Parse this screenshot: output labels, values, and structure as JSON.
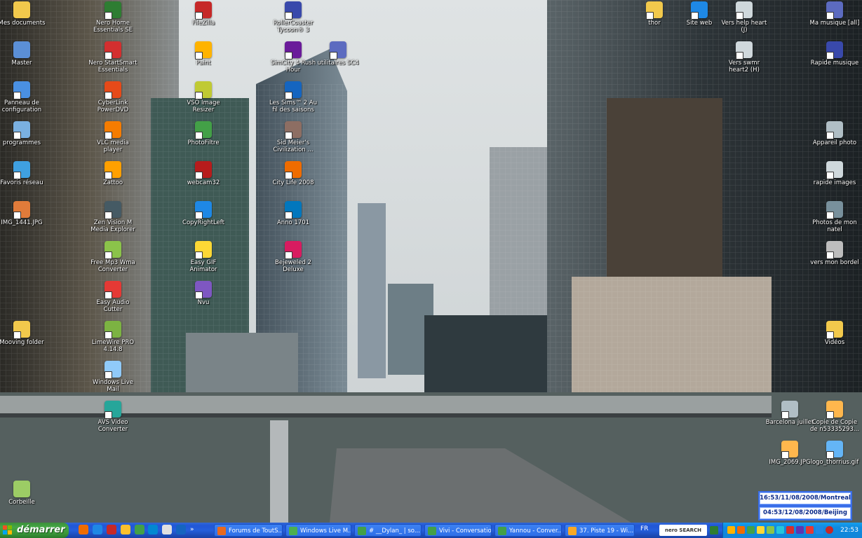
{
  "colors": {
    "taskbar": "#245edb",
    "start_button": "#3c973a",
    "tray": "#1285d8",
    "clock_text": "#0a2a8a"
  },
  "desktop_icons": [
    {
      "label": "Mes documents",
      "icon": "folder-documents-icon",
      "color": "#f2c94c"
    },
    {
      "label": "Master",
      "icon": "computer-icon",
      "color": "#5b8fd6"
    },
    {
      "label": "Panneau de configuration",
      "icon": "control-panel-icon",
      "color": "#4a90e2"
    },
    {
      "label": "programmes",
      "icon": "programs-icon",
      "color": "#7ab0e0"
    },
    {
      "label": "Favoris réseau",
      "icon": "network-icon",
      "color": "#3fa0e0"
    },
    {
      "label": "IMG_1441.JPG",
      "icon": "image-file-icon",
      "color": "#e07b3a"
    },
    {
      "label": "Mooving folder",
      "icon": "folder-icon",
      "color": "#f2c94c"
    },
    {
      "label": "Corbeille",
      "icon": "recycle-bin-icon",
      "color": "#9ccc65"
    },
    {
      "label": "Nero Home Essentials SE",
      "icon": "nero-home-icon",
      "color": "#2e7d32"
    },
    {
      "label": "Nero StartSmart Essentials",
      "icon": "nero-startsmart-icon",
      "color": "#d32f2f"
    },
    {
      "label": "CyberLink PowerDVD",
      "icon": "powerdvd-icon",
      "color": "#e64a19"
    },
    {
      "label": "VLC media player",
      "icon": "vlc-icon",
      "color": "#f57c00"
    },
    {
      "label": "Zattoo",
      "icon": "zattoo-icon",
      "color": "#ffa000"
    },
    {
      "label": "Zen Vision M Media Explorer",
      "icon": "zen-explorer-icon",
      "color": "#455a64"
    },
    {
      "label": "Free Mp3 Wma Converter",
      "icon": "mp3-converter-icon",
      "color": "#8bc34a"
    },
    {
      "label": "Easy Audio Cutter",
      "icon": "audio-cutter-icon",
      "color": "#e53935"
    },
    {
      "label": "LimeWire PRO 4.14.8",
      "icon": "limewire-icon",
      "color": "#7cb342"
    },
    {
      "label": "Windows Live Mail",
      "icon": "live-mail-icon",
      "color": "#90caf9"
    },
    {
      "label": "AVS Video Converter",
      "icon": "avs-converter-icon",
      "color": "#26a69a"
    },
    {
      "label": "FileZilla",
      "icon": "filezilla-icon",
      "color": "#c62828"
    },
    {
      "label": "Paint",
      "icon": "paint-icon",
      "color": "#ffb300"
    },
    {
      "label": "VSO Image Resizer",
      "icon": "image-resizer-icon",
      "color": "#c0ca33"
    },
    {
      "label": "PhotoFiltre",
      "icon": "photofiltre-icon",
      "color": "#43a047"
    },
    {
      "label": "webcam32",
      "icon": "webcam-icon",
      "color": "#b71c1c"
    },
    {
      "label": "CopyRightLeft",
      "icon": "copyrightleft-icon",
      "color": "#1e88e5"
    },
    {
      "label": "Easy GIF Animator",
      "icon": "gif-animator-icon",
      "color": "#fdd835"
    },
    {
      "label": "Nvu",
      "icon": "nvu-icon",
      "color": "#7e57c2"
    },
    {
      "label": "RollerCoaster Tycoon® 3",
      "icon": "rollercoaster-icon",
      "color": "#3949ab"
    },
    {
      "label": "SimCity 4 Rush Hour",
      "icon": "simcity-icon",
      "color": "#6a1b9a"
    },
    {
      "label": "utilitaires SC4",
      "icon": "gear-icon",
      "color": "#5c6bc0"
    },
    {
      "label": "Les Sims™ 2 Au fil des saisons",
      "icon": "sims-icon",
      "color": "#1565c0"
    },
    {
      "label": "Sid Meier's Civilization ...",
      "icon": "civilization-icon",
      "color": "#8d6e63"
    },
    {
      "label": "City Life 2008",
      "icon": "city-life-icon",
      "color": "#ef6c00"
    },
    {
      "label": "Anno 1701",
      "icon": "anno-icon",
      "color": "#0277bd"
    },
    {
      "label": "Bejeweled 2 Deluxe",
      "icon": "bejeweled-icon",
      "color": "#d81b60"
    },
    {
      "label": "thor",
      "icon": "folder-icon",
      "color": "#f2c94c"
    },
    {
      "label": "Site web",
      "icon": "globe-icon",
      "color": "#1e88e5"
    },
    {
      "label": "Vers help heart (J)",
      "icon": "drive-icon",
      "color": "#cfd8dc"
    },
    {
      "label": "Vers swmr heart2 (H)",
      "icon": "drive-icon",
      "color": "#cfd8dc"
    },
    {
      "label": "Ma musique [all]",
      "icon": "music-icon",
      "color": "#5c6bc0"
    },
    {
      "label": "Rapide musique",
      "icon": "music-icon",
      "color": "#3949ab"
    },
    {
      "label": "Appareil photo",
      "icon": "camera-icon",
      "color": "#b0bec5"
    },
    {
      "label": "rapide images",
      "icon": "camera-icon",
      "color": "#cfd8dc"
    },
    {
      "label": "Photos de mon natel",
      "icon": "phone-icon",
      "color": "#78909c"
    },
    {
      "label": "vers mon bordel",
      "icon": "folder-network-icon",
      "color": "#bdbdbd"
    },
    {
      "label": "Vidéos",
      "icon": "folder-videos-icon",
      "color": "#f2c94c"
    },
    {
      "label": "Barcelona juillet",
      "icon": "camera-icon",
      "color": "#b0bec5"
    },
    {
      "label": "Copie de Copie de n53335293...",
      "icon": "image-file-icon",
      "color": "#ffb74d"
    },
    {
      "label": "IMG_2069.JPG",
      "icon": "image-file-icon",
      "color": "#ffb74d"
    },
    {
      "label": "logo_thorrius.gif",
      "icon": "image-file-icon",
      "color": "#64b5f6"
    }
  ],
  "world_clocks": [
    "16:53/11/08/2008/Montreal",
    "04:53/12/08/2008/Beijing"
  ],
  "taskbar": {
    "start_label": "démarrer",
    "buttons": [
      {
        "label": "Forums de ToutS...",
        "icon": "firefox-icon",
        "color": "#e8691e"
      },
      {
        "label": "Windows Live M...",
        "icon": "live-messenger-icon",
        "color": "#4caf50"
      },
      {
        "label": "# __Dylan_ | so...",
        "icon": "messenger-chat-icon",
        "color": "#43a047"
      },
      {
        "label": "Vivi - Conversation",
        "icon": "messenger-chat-icon",
        "color": "#43a047"
      },
      {
        "label": "Yannou - Conver...",
        "icon": "messenger-chat-icon",
        "color": "#43a047"
      },
      {
        "label": "37. Piste 19 - Wi...",
        "icon": "winamp-icon",
        "color": "#f9a825"
      }
    ],
    "language": "FR",
    "nero_search": "nero SEARCH",
    "clock": "22:53"
  }
}
